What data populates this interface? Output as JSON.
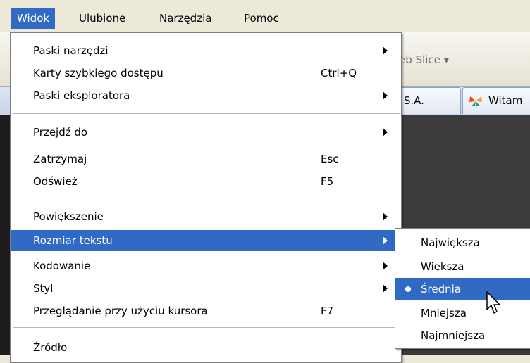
{
  "menubar": {
    "items": [
      {
        "label": "Widok",
        "active": true
      },
      {
        "label": "Ulubione"
      },
      {
        "label": "Narzędzia"
      },
      {
        "label": "Pomoc"
      }
    ]
  },
  "background": {
    "web_slice": "eb Slice ▾",
    "tab1": ": S.A.",
    "tab2": "Witam"
  },
  "view_menu": {
    "items": [
      {
        "label": "Paski narzędzi",
        "submenu": true
      },
      {
        "label": "Karty szybkiego dostępu",
        "shortcut": "Ctrl+Q"
      },
      {
        "label": "Paski eksploratora",
        "submenu": true
      },
      {
        "label": "Przejdź do",
        "submenu": true
      },
      {
        "label": "Zatrzymaj",
        "shortcut": "Esc"
      },
      {
        "label": "Odśwież",
        "shortcut": "F5"
      },
      {
        "label": "Powiększenie",
        "submenu": true
      },
      {
        "label": "Rozmiar tekstu",
        "submenu": true,
        "highlighted": true
      },
      {
        "label": "Kodowanie",
        "submenu": true
      },
      {
        "label": "Styl",
        "submenu": true
      },
      {
        "label": "Przeglądanie przy użyciu kursora",
        "shortcut": "F7"
      },
      {
        "label": "Źródło"
      }
    ]
  },
  "text_size_menu": {
    "items": [
      {
        "label": "Największa"
      },
      {
        "label": "Większa"
      },
      {
        "label": "Średnia",
        "selected": true,
        "highlighted": true
      },
      {
        "label": "Mniejsza"
      },
      {
        "label": "Najmniejsza"
      }
    ]
  },
  "colors": {
    "highlight": "#316ac5",
    "menubar_bg": "#ece9d8"
  }
}
